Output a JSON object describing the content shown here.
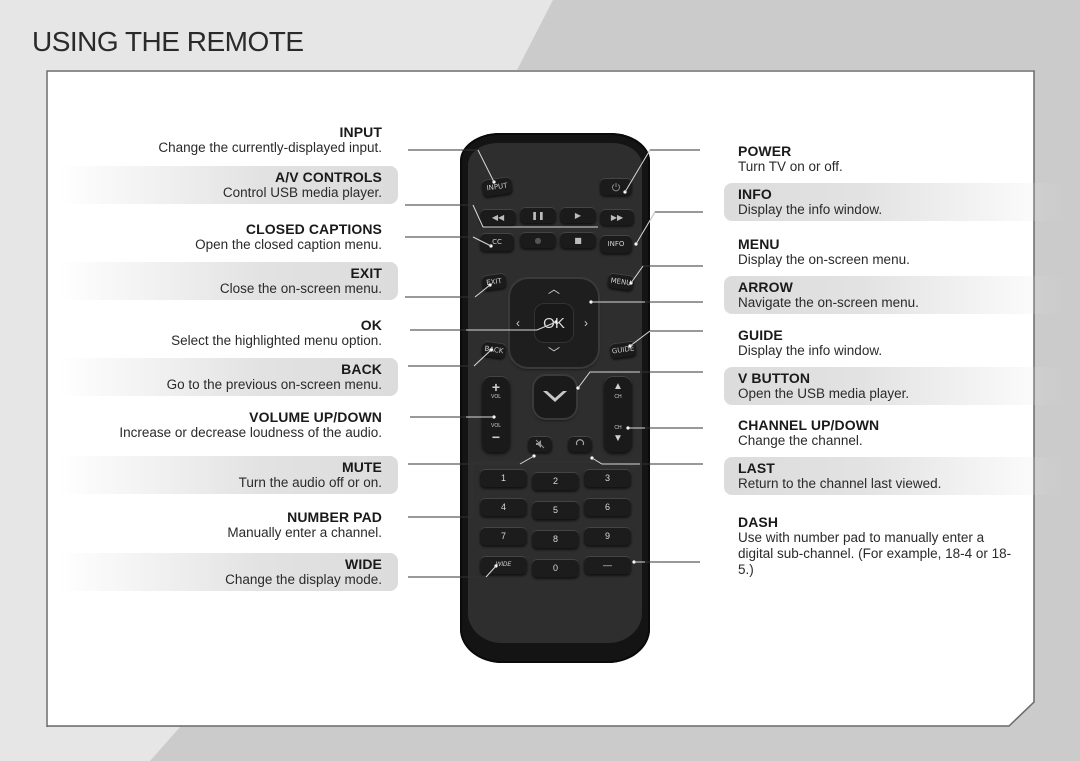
{
  "page": {
    "title": "USING THE REMOTE"
  },
  "callouts_left": [
    {
      "name": "INPUT",
      "desc": "Change the currently-displayed input.",
      "shaded": false
    },
    {
      "name": "A/V CONTROLS",
      "desc": "Control USB media player.",
      "shaded": true
    },
    {
      "name": "CLOSED CAPTIONS",
      "desc": "Open the closed caption menu.",
      "shaded": false
    },
    {
      "name": "EXIT",
      "desc": "Close the on-screen menu.",
      "shaded": true
    },
    {
      "name": "OK",
      "desc": "Select the highlighted menu option.",
      "shaded": false
    },
    {
      "name": "BACK",
      "desc": "Go to the previous on-screen menu.",
      "shaded": true
    },
    {
      "name": "VOLUME UP/DOWN",
      "desc": "Increase or decrease loudness of the audio.",
      "shaded": false
    },
    {
      "name": "MUTE",
      "desc": "Turn the audio off or on.",
      "shaded": true
    },
    {
      "name": "NUMBER PAD",
      "desc": "Manually enter a channel.",
      "shaded": false
    },
    {
      "name": "WIDE",
      "desc": "Change the display mode.",
      "shaded": true
    }
  ],
  "callouts_right": [
    {
      "name": "POWER",
      "desc": "Turn TV on or off.",
      "shaded": false
    },
    {
      "name": "INFO",
      "desc": "Display the info window.",
      "shaded": true
    },
    {
      "name": "MENU",
      "desc": "Display the on-screen menu.",
      "shaded": false
    },
    {
      "name": "ARROW",
      "desc": "Navigate the on-screen menu.",
      "shaded": true
    },
    {
      "name": "GUIDE",
      "desc": "Display the info window.",
      "shaded": false
    },
    {
      "name": "V BUTTON",
      "desc": "Open the USB media player.",
      "shaded": true
    },
    {
      "name": "CHANNEL UP/DOWN",
      "desc": "Change the channel.",
      "shaded": false
    },
    {
      "name": "LAST",
      "desc": "Return to the channel last viewed.",
      "shaded": true
    },
    {
      "name": "DASH",
      "desc": "Use with number pad to manually enter a digital sub-channel. (For example, 18-4 or 18-5.)",
      "shaded": false
    }
  ],
  "remote": {
    "input_label": "INPUT",
    "power_icon": "power-icon",
    "rewind_glyph": "◀◀",
    "pause_glyph": "❚❚",
    "play_glyph": "▶",
    "ffwd_glyph": "▶▶",
    "cc_label": "CC",
    "record_glyph": "●",
    "stop_glyph": "■",
    "info_label": "INFO",
    "exit_label": "EXIT",
    "menu_label": "MENU",
    "ok_label": "OK",
    "back_label": "BACK",
    "guide_label": "GUIDE",
    "vol_label": "VOL",
    "vol_up": "+",
    "vol_down": "−",
    "ch_label": "CH",
    "ch_up": "▲",
    "ch_down": "▼",
    "mute_icon": "mute-icon",
    "last_icon": "last-icon",
    "wide_label": "WIDE",
    "dash_glyph": "—",
    "numbers": [
      "1",
      "2",
      "3",
      "4",
      "5",
      "6",
      "7",
      "8",
      "9",
      "0"
    ]
  }
}
